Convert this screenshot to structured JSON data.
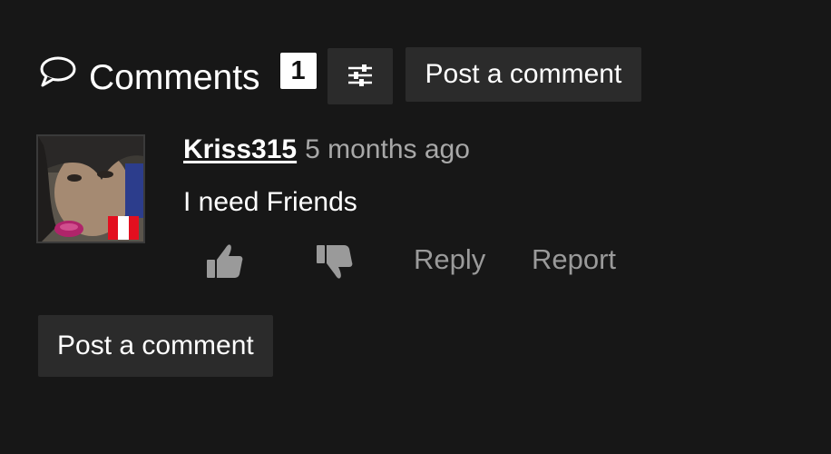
{
  "header": {
    "title": "Comments",
    "count": "1",
    "sort_icon": "sliders-icon",
    "post_button_label": "Post a comment"
  },
  "comments": [
    {
      "username": "Kriss315",
      "time": "5 months ago",
      "text": "I need Friends",
      "avatar_flag_colors": [
        "#e30f1f",
        "#ffffff",
        "#e30f1f"
      ],
      "actions": {
        "like_icon": "thumbs-up-icon",
        "dislike_icon": "thumbs-down-icon",
        "reply_label": "Reply",
        "report_label": "Report"
      }
    }
  ],
  "footer": {
    "post_button_label": "Post a comment"
  },
  "colors": {
    "background": "#171717",
    "button_bg": "#2b2b2b",
    "muted_text": "#9a9a9a",
    "time_text": "#a8a8a8"
  }
}
